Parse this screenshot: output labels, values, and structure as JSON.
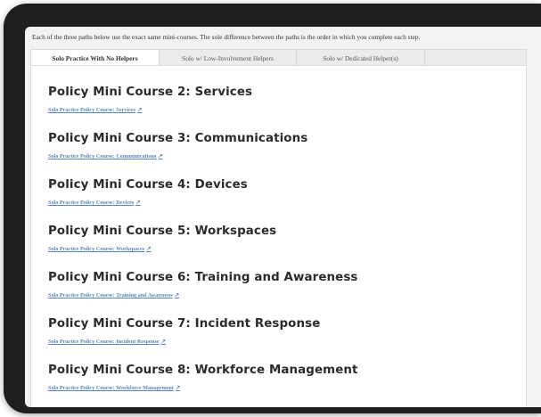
{
  "intro_text": "Each of the three paths below use the exact same mini-courses. The sole difference between the paths is the order in which you complete each step.",
  "tabs": [
    {
      "label": "Solo Practice With No Helpers",
      "active": true
    },
    {
      "label": "Solo w/ Low-Involvement Helpers",
      "active": false
    },
    {
      "label": "Solo w/ Dedicated Helper(s)",
      "active": false
    }
  ],
  "courses": [
    {
      "title": "Policy Mini Course 2: Services",
      "link": "Solo Practice Policy Course: Services"
    },
    {
      "title": "Policy Mini Course 3: Communications",
      "link": "Solo Practice Policy Course: Communications"
    },
    {
      "title": "Policy Mini Course 4: Devices",
      "link": "Solo Practice Policy Course: Devices"
    },
    {
      "title": "Policy Mini Course 5: Workspaces",
      "link": "Solo Practice Policy Course: Workspaces"
    },
    {
      "title": "Policy Mini Course 6: Training and Awareness",
      "link": "Solo Practice Policy Course: Training and Awareness"
    },
    {
      "title": "Policy Mini Course 7: Incident Response",
      "link": "Solo Practice Policy Course: Incident Response"
    },
    {
      "title": "Policy Mini Course 8: Workforce Management",
      "link": "Solo Practice Policy Course: Workforce Management"
    }
  ],
  "link_icon": "external-link-icon",
  "colors": {
    "link": "#5b88b8",
    "heading": "#2b2b2b",
    "bezel": "#1e1e1e"
  }
}
